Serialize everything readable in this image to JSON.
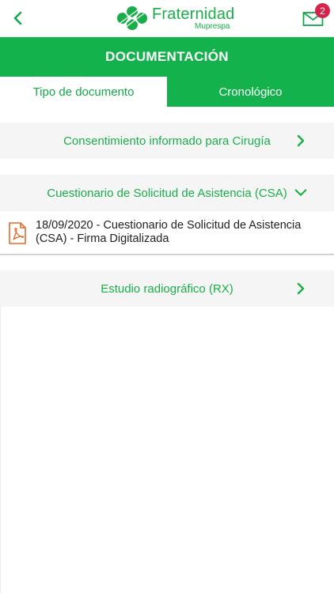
{
  "header": {
    "logo_main": "Fraternidad",
    "logo_sub": "Muprespa",
    "notifications_count": "2",
    "brand_color": "#13b24c",
    "badge_color": "#d6234b"
  },
  "page": {
    "title": "DOCUMENTACIÓN"
  },
  "tabs": [
    {
      "label": "Tipo de documento",
      "active": true
    },
    {
      "label": "Cronológico",
      "active": false
    }
  ],
  "sections": [
    {
      "label": "Consentimiento informado para Cirugía",
      "expanded": false,
      "icon": "chevron-right-icon"
    },
    {
      "label": "Cuestionario de Solicitud de Asistencia (CSA)",
      "expanded": true,
      "icon": "chevron-down-icon",
      "documents": [
        {
          "title": "18/09/2020 - Cuestionario de Solicitud de Asistencia (CSA) - Firma Digitalizada",
          "icon": "pdf-icon"
        }
      ]
    },
    {
      "label": "Estudio radiográfico (RX)",
      "expanded": false,
      "icon": "chevron-right-icon"
    }
  ]
}
